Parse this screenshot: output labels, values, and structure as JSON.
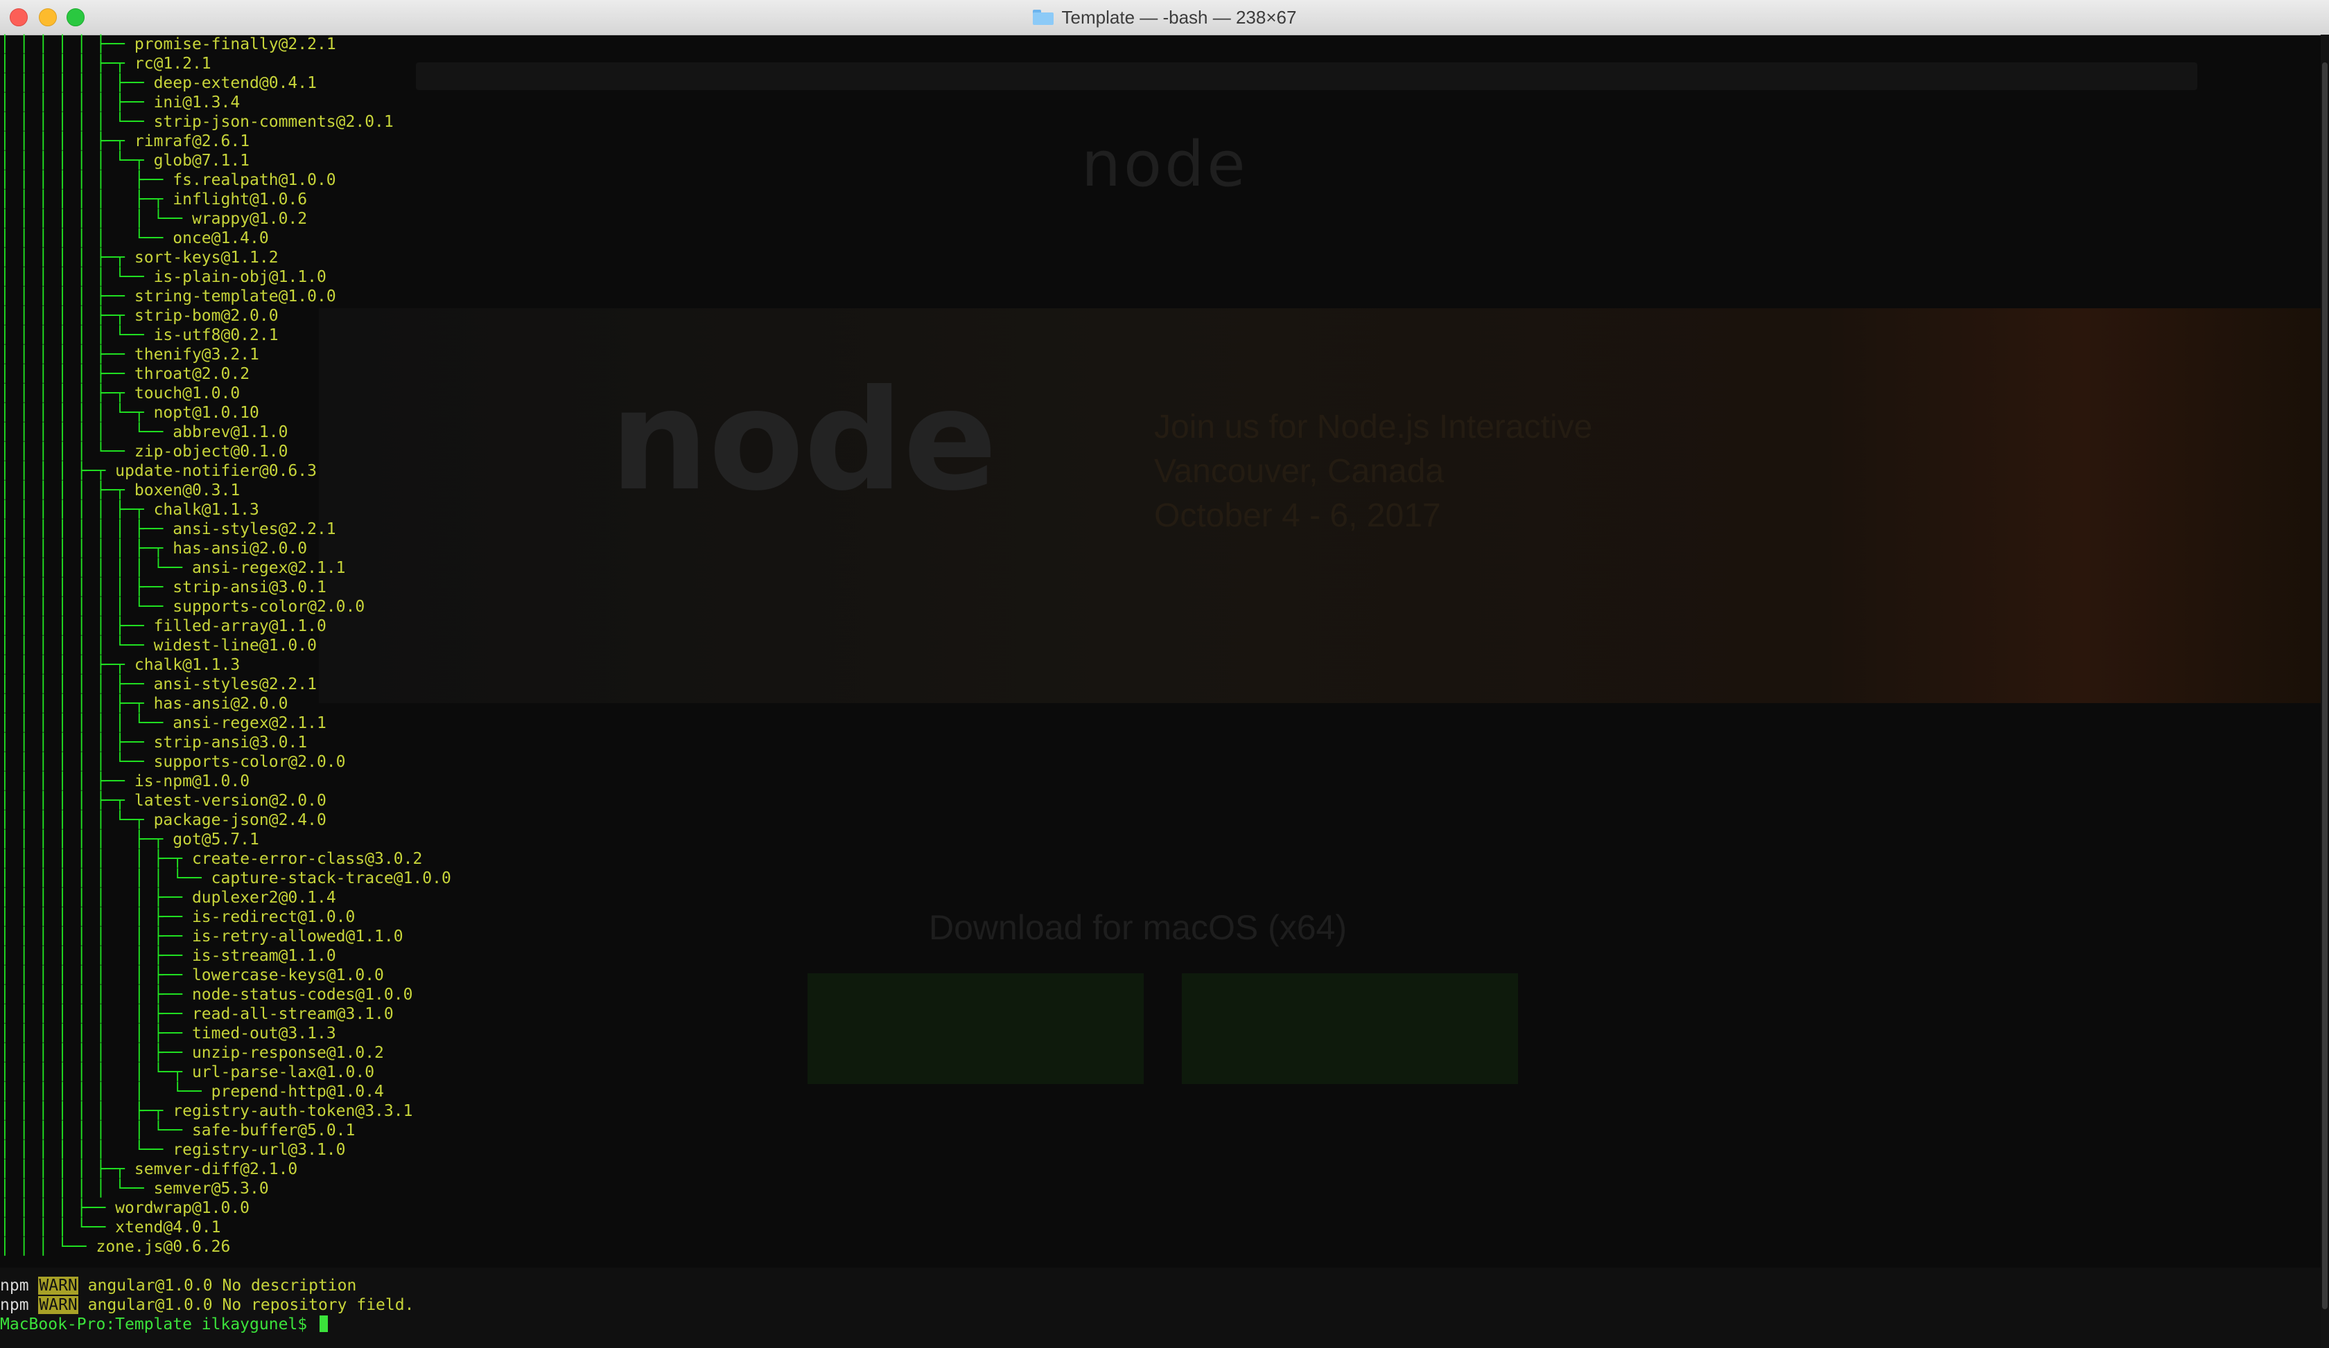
{
  "window": {
    "title": "Template — -bash — 238×67"
  },
  "background_page": {
    "logo_text": "node",
    "hero_title_line1": "Join us for Node.js Interactive",
    "hero_title_line2": "Vancouver, Canada",
    "hero_date": "October 4 - 6, 2017",
    "download_heading": "Download for macOS (x64)"
  },
  "tree": [
    {
      "g": "│ │ │ │ │ ├─┬ ",
      "p": "rc@1.2.1"
    },
    {
      "g": "│ │ │ │ │ │ ├── ",
      "p": "deep-extend@0.4.1"
    },
    {
      "g": "│ │ │ │ │ │ ├── ",
      "p": "ini@1.3.4"
    },
    {
      "g": "│ │ │ │ │ │ └── ",
      "p": "strip-json-comments@2.0.1"
    },
    {
      "g": "│ │ │ │ │ ├─┬ ",
      "p": "rimraf@2.6.1"
    },
    {
      "g": "│ │ │ │ │ │ └─┬ ",
      "p": "glob@7.1.1"
    },
    {
      "g": "│ │ │ │ │ │   ├── ",
      "p": "fs.realpath@1.0.0"
    },
    {
      "g": "│ │ │ │ │ │   ├─┬ ",
      "p": "inflight@1.0.6"
    },
    {
      "g": "│ │ │ │ │ │   │ └── ",
      "p": "wrappy@1.0.2"
    },
    {
      "g": "│ │ │ │ │ │   └── ",
      "p": "once@1.4.0"
    },
    {
      "g": "│ │ │ │ │ ├─┬ ",
      "p": "sort-keys@1.1.2"
    },
    {
      "g": "│ │ │ │ │ │ └── ",
      "p": "is-plain-obj@1.1.0"
    },
    {
      "g": "│ │ │ │ │ ├── ",
      "p": "string-template@1.0.0"
    },
    {
      "g": "│ │ │ │ │ ├─┬ ",
      "p": "strip-bom@2.0.0"
    },
    {
      "g": "│ │ │ │ │ │ └── ",
      "p": "is-utf8@0.2.1"
    },
    {
      "g": "│ │ │ │ │ ├── ",
      "p": "thenify@3.2.1"
    },
    {
      "g": "│ │ │ │ │ ├── ",
      "p": "throat@2.0.2"
    },
    {
      "g": "│ │ │ │ │ ├─┬ ",
      "p": "touch@1.0.0"
    },
    {
      "g": "│ │ │ │ │ │ └─┬ ",
      "p": "nopt@1.0.10"
    },
    {
      "g": "│ │ │ │ │ │   └── ",
      "p": "abbrev@1.1.0"
    },
    {
      "g": "│ │ │ │ │ └── ",
      "p": "zip-object@0.1.0"
    },
    {
      "g": "│ │ │ │ ├─┬ ",
      "p": "update-notifier@0.6.3"
    },
    {
      "g": "│ │ │ │ │ ├─┬ ",
      "p": "boxen@0.3.1"
    },
    {
      "g": "│ │ │ │ │ │ ├─┬ ",
      "p": "chalk@1.1.3"
    },
    {
      "g": "│ │ │ │ │ │ │ ├── ",
      "p": "ansi-styles@2.2.1"
    },
    {
      "g": "│ │ │ │ │ │ │ ├─┬ ",
      "p": "has-ansi@2.0.0"
    },
    {
      "g": "│ │ │ │ │ │ │ │ └── ",
      "p": "ansi-regex@2.1.1"
    },
    {
      "g": "│ │ │ │ │ │ │ ├── ",
      "p": "strip-ansi@3.0.1"
    },
    {
      "g": "│ │ │ │ │ │ │ └── ",
      "p": "supports-color@2.0.0"
    },
    {
      "g": "│ │ │ │ │ │ ├── ",
      "p": "filled-array@1.1.0"
    },
    {
      "g": "│ │ │ │ │ │ └── ",
      "p": "widest-line@1.0.0"
    },
    {
      "g": "│ │ │ │ │ ├─┬ ",
      "p": "chalk@1.1.3"
    },
    {
      "g": "│ │ │ │ │ │ ├── ",
      "p": "ansi-styles@2.2.1"
    },
    {
      "g": "│ │ │ │ │ │ ├─┬ ",
      "p": "has-ansi@2.0.0"
    },
    {
      "g": "│ │ │ │ │ │ │ └── ",
      "p": "ansi-regex@2.1.1"
    },
    {
      "g": "│ │ │ │ │ │ ├── ",
      "p": "strip-ansi@3.0.1"
    },
    {
      "g": "│ │ │ │ │ │ └── ",
      "p": "supports-color@2.0.0"
    },
    {
      "g": "│ │ │ │ │ ├── ",
      "p": "is-npm@1.0.0"
    },
    {
      "g": "│ │ │ │ │ ├─┬ ",
      "p": "latest-version@2.0.0"
    },
    {
      "g": "│ │ │ │ │ │ └─┬ ",
      "p": "package-json@2.4.0"
    },
    {
      "g": "│ │ │ │ │ │   ├─┬ ",
      "p": "got@5.7.1"
    },
    {
      "g": "│ │ │ │ │ │   │ ├─┬ ",
      "p": "create-error-class@3.0.2"
    },
    {
      "g": "│ │ │ │ │ │   │ │ └── ",
      "p": "capture-stack-trace@1.0.0"
    },
    {
      "g": "│ │ │ │ │ │   │ ├── ",
      "p": "duplexer2@0.1.4"
    },
    {
      "g": "│ │ │ │ │ │   │ ├── ",
      "p": "is-redirect@1.0.0"
    },
    {
      "g": "│ │ │ │ │ │   │ ├── ",
      "p": "is-retry-allowed@1.1.0"
    },
    {
      "g": "│ │ │ │ │ │   │ ├── ",
      "p": "is-stream@1.1.0"
    },
    {
      "g": "│ │ │ │ │ │   │ ├── ",
      "p": "lowercase-keys@1.0.0"
    },
    {
      "g": "│ │ │ │ │ │   │ ├── ",
      "p": "node-status-codes@1.0.0"
    },
    {
      "g": "│ │ │ │ │ │   │ ├── ",
      "p": "read-all-stream@3.1.0"
    },
    {
      "g": "│ │ │ │ │ │   │ ├── ",
      "p": "timed-out@3.1.3"
    },
    {
      "g": "│ │ │ │ │ │   │ ├── ",
      "p": "unzip-response@1.0.2"
    },
    {
      "g": "│ │ │ │ │ │   │ └─┬ ",
      "p": "url-parse-lax@1.0.0"
    },
    {
      "g": "│ │ │ │ │ │   │   └── ",
      "p": "prepend-http@1.0.4"
    },
    {
      "g": "│ │ │ │ │ │   ├─┬ ",
      "p": "registry-auth-token@3.3.1"
    },
    {
      "g": "│ │ │ │ │ │   │ └── ",
      "p": "safe-buffer@5.0.1"
    },
    {
      "g": "│ │ │ │ │ │   └── ",
      "p": "registry-url@3.1.0"
    },
    {
      "g": "│ │ │ │ │ ├─┬ ",
      "p": "semver-diff@2.1.0"
    },
    {
      "g": "│ │ │ │ │ │ └── ",
      "p": "semver@5.3.0"
    },
    {
      "g": "│ │ │ │ ├── ",
      "p": "wordwrap@1.0.0"
    },
    {
      "g": "│ │ │ │ └── ",
      "p": "xtend@4.0.1"
    },
    {
      "g": "│ │ │ └── ",
      "p": "zone.js@0.6.26"
    }
  ],
  "tree_top_line": {
    "g": "│ │ │ │ │ ├── ",
    "p": "promise-finally@2.2.1"
  },
  "npm_output": [
    {
      "prefix": "npm ",
      "level": "WARN",
      "message": " angular@1.0.0 No description"
    },
    {
      "prefix": "npm ",
      "level": "WARN",
      "message": " angular@1.0.0 No repository field."
    }
  ],
  "prompt": "MacBook-Pro:Template ilkaygunel$ "
}
